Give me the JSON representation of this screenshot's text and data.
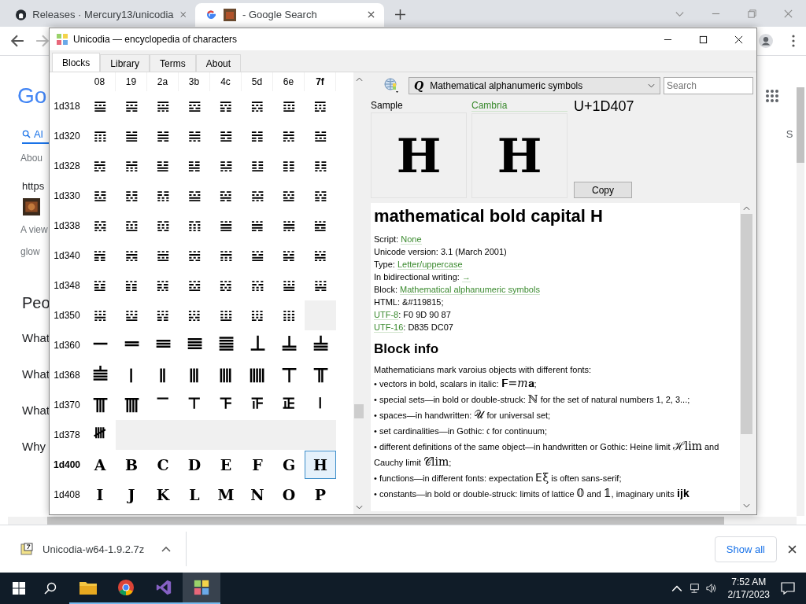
{
  "browser": {
    "tabs": [
      {
        "title": "Releases · Mercury13/unicodia",
        "selected": false
      },
      {
        "title": "- Google Search",
        "selected": true
      }
    ],
    "page_left": [
      {
        "kind": "logo",
        "text": "Go"
      },
      {
        "kind": "tab",
        "text": "Al"
      },
      {
        "kind": "small",
        "text": "Abou"
      },
      {
        "kind": "url",
        "text": "https"
      },
      {
        "kind": "thumb"
      },
      {
        "kind": "small",
        "text": "A view"
      },
      {
        "kind": "small",
        "text": "glow"
      },
      {
        "kind": "heading",
        "text": "Peo"
      },
      {
        "kind": "question",
        "text": "What"
      },
      {
        "kind": "question",
        "text": "What"
      },
      {
        "kind": "question",
        "text": "What"
      },
      {
        "kind": "question",
        "text": "Why"
      }
    ],
    "page_right": {
      "tab": "S"
    }
  },
  "window": {
    "title": "Unicodia — encyclopedia of characters",
    "tabs": [
      {
        "label": "Blocks",
        "selected": true
      },
      {
        "label": "Library",
        "selected": false
      },
      {
        "label": "Terms",
        "selected": false
      },
      {
        "label": "About",
        "selected": false
      }
    ]
  },
  "grid": {
    "columns": [
      {
        "label": "08",
        "current": false
      },
      {
        "label": "19",
        "current": false
      },
      {
        "label": "2a",
        "current": false
      },
      {
        "label": "3b",
        "current": false
      },
      {
        "label": "4c",
        "current": false
      },
      {
        "label": "5d",
        "current": false
      },
      {
        "label": "6e",
        "current": false
      },
      {
        "label": "7f",
        "current": true
      }
    ],
    "rows": [
      {
        "label": "1d318",
        "current": false,
        "cells": [
          {
            "char": "𝌘",
            "selected": false
          },
          {
            "char": "𝌙",
            "selected": false
          },
          {
            "char": "𝌚",
            "selected": false
          },
          {
            "char": "𝌛",
            "selected": false
          },
          {
            "char": "𝌜",
            "selected": false
          },
          {
            "char": "𝌝",
            "selected": false
          },
          {
            "char": "𝌞",
            "selected": false
          },
          {
            "char": "𝌟",
            "selected": false
          }
        ]
      },
      {
        "label": "1d320",
        "current": false,
        "cells": [
          {
            "char": "𝌠",
            "selected": false
          },
          {
            "char": "𝌡",
            "selected": false
          },
          {
            "char": "𝌢",
            "selected": false
          },
          {
            "char": "𝌣",
            "selected": false
          },
          {
            "char": "𝌤",
            "selected": false
          },
          {
            "char": "𝌥",
            "selected": false
          },
          {
            "char": "𝌦",
            "selected": false
          },
          {
            "char": "𝌧",
            "selected": false
          }
        ]
      },
      {
        "label": "1d328",
        "current": false,
        "cells": [
          {
            "char": "𝌨",
            "selected": false
          },
          {
            "char": "𝌩",
            "selected": false
          },
          {
            "char": "𝌪",
            "selected": false
          },
          {
            "char": "𝌫",
            "selected": false
          },
          {
            "char": "𝌬",
            "selected": false
          },
          {
            "char": "𝌭",
            "selected": false
          },
          {
            "char": "𝌮",
            "selected": false
          },
          {
            "char": "𝌯",
            "selected": false
          }
        ]
      },
      {
        "label": "1d330",
        "current": false,
        "cells": [
          {
            "char": "𝌰",
            "selected": false
          },
          {
            "char": "𝌱",
            "selected": false
          },
          {
            "char": "𝌲",
            "selected": false
          },
          {
            "char": "𝌳",
            "selected": false
          },
          {
            "char": "𝌴",
            "selected": false
          },
          {
            "char": "𝌵",
            "selected": false
          },
          {
            "char": "𝌶",
            "selected": false
          },
          {
            "char": "𝌷",
            "selected": false
          }
        ]
      },
      {
        "label": "1d338",
        "current": false,
        "cells": [
          {
            "char": "𝌸",
            "selected": false
          },
          {
            "char": "𝌹",
            "selected": false
          },
          {
            "char": "𝌺",
            "selected": false
          },
          {
            "char": "𝌻",
            "selected": false
          },
          {
            "char": "𝌼",
            "selected": false
          },
          {
            "char": "𝌽",
            "selected": false
          },
          {
            "char": "𝌾",
            "selected": false
          },
          {
            "char": "𝌿",
            "selected": false
          }
        ]
      },
      {
        "label": "1d340",
        "current": false,
        "cells": [
          {
            "char": "𝍀",
            "selected": false
          },
          {
            "char": "𝍁",
            "selected": false
          },
          {
            "char": "𝍂",
            "selected": false
          },
          {
            "char": "𝍃",
            "selected": false
          },
          {
            "char": "𝍄",
            "selected": false
          },
          {
            "char": "𝍅",
            "selected": false
          },
          {
            "char": "𝍆",
            "selected": false
          },
          {
            "char": "𝍇",
            "selected": false
          }
        ]
      },
      {
        "label": "1d348",
        "current": false,
        "cells": [
          {
            "char": "𝍈",
            "selected": false
          },
          {
            "char": "𝍉",
            "selected": false
          },
          {
            "char": "𝍊",
            "selected": false
          },
          {
            "char": "𝍋",
            "selected": false
          },
          {
            "char": "𝍌",
            "selected": false
          },
          {
            "char": "𝍍",
            "selected": false
          },
          {
            "char": "𝍎",
            "selected": false
          },
          {
            "char": "𝍏",
            "selected": false
          }
        ]
      },
      {
        "label": "1d350",
        "current": false,
        "cells": [
          {
            "char": "𝍐",
            "selected": false
          },
          {
            "char": "𝍑",
            "selected": false
          },
          {
            "char": "𝍒",
            "selected": false
          },
          {
            "char": "𝍓",
            "selected": false
          },
          {
            "char": "𝍔",
            "selected": false
          },
          {
            "char": "𝍕",
            "selected": false
          },
          {
            "char": "𝍖",
            "selected": false
          }
        ]
      },
      {
        "label": "1d360",
        "current": false,
        "cells": [
          {
            "char": "𝍠",
            "selected": false
          },
          {
            "char": "𝍡",
            "selected": false
          },
          {
            "char": "𝍢",
            "selected": false
          },
          {
            "char": "𝍣",
            "selected": false
          },
          {
            "char": "𝍤",
            "selected": false
          },
          {
            "char": "𝍥",
            "selected": false
          },
          {
            "char": "𝍦",
            "selected": false
          },
          {
            "char": "𝍧",
            "selected": false
          }
        ]
      },
      {
        "label": "1d368",
        "current": false,
        "cells": [
          {
            "char": "𝍨",
            "selected": false
          },
          {
            "char": "𝍩",
            "selected": false
          },
          {
            "char": "𝍪",
            "selected": false
          },
          {
            "char": "𝍫",
            "selected": false
          },
          {
            "char": "𝍬",
            "selected": false
          },
          {
            "char": "𝍭",
            "selected": false
          },
          {
            "char": "𝍮",
            "selected": false
          },
          {
            "char": "𝍯",
            "selected": false
          }
        ]
      },
      {
        "label": "1d370",
        "current": false,
        "cells": [
          {
            "char": "𝍰",
            "selected": false
          },
          {
            "char": "𝍱",
            "selected": false
          },
          {
            "char": "𝍲",
            "selected": false
          },
          {
            "char": "𝍳",
            "selected": false
          },
          {
            "char": "𝍴",
            "selected": false
          },
          {
            "char": "𝍵",
            "selected": false
          },
          {
            "char": "𝍶",
            "selected": false
          },
          {
            "char": "𝍷",
            "selected": false
          }
        ]
      },
      {
        "label": "1d378",
        "current": false,
        "cells": [
          {
            "char": "𝍸",
            "selected": false
          }
        ]
      },
      {
        "label": "1d400",
        "current": true,
        "cells": [
          {
            "char": "𝐀",
            "selected": false
          },
          {
            "char": "𝐁",
            "selected": false
          },
          {
            "char": "𝐂",
            "selected": false
          },
          {
            "char": "𝐃",
            "selected": false
          },
          {
            "char": "𝐄",
            "selected": false
          },
          {
            "char": "𝐅",
            "selected": false
          },
          {
            "char": "𝐆",
            "selected": false
          },
          {
            "char": "𝐇",
            "selected": true
          }
        ]
      },
      {
        "label": "1d408",
        "current": false,
        "cells": [
          {
            "char": "𝐈",
            "selected": false
          },
          {
            "char": "𝐉",
            "selected": false
          },
          {
            "char": "𝐊",
            "selected": false
          },
          {
            "char": "𝐋",
            "selected": false
          },
          {
            "char": "𝐌",
            "selected": false
          },
          {
            "char": "𝐍",
            "selected": false
          },
          {
            "char": "𝐎",
            "selected": false
          },
          {
            "char": "𝐏",
            "selected": false
          }
        ]
      }
    ]
  },
  "toolbar": {
    "block_icon": "𝑸",
    "block": "Mathematical alphanumeric symbols",
    "search": {
      "placeholder": "Search"
    }
  },
  "samples": [
    {
      "label": "Sample",
      "link": false,
      "char": "𝐇"
    },
    {
      "label": "Cambria",
      "link": true,
      "char": "𝐇"
    }
  ],
  "code": "U+1D407",
  "copy": "Copy",
  "info": {
    "title": "mathematical bold capital H",
    "lines": [
      [
        {
          "text": "Script: ",
          "link": false
        },
        {
          "text": "None",
          "link": true
        }
      ],
      [
        {
          "text": "Unicode version: 3.1 (March 2001)",
          "link": false
        }
      ],
      [
        {
          "text": "Type: ",
          "link": false
        },
        {
          "text": "Letter/uppercase",
          "link": true
        }
      ],
      [
        {
          "text": "In bidirectional writing: ",
          "link": false
        },
        {
          "text": "→",
          "link": true
        }
      ],
      [
        {
          "text": "Block: ",
          "link": false
        },
        {
          "text": "Mathematical alphanumeric symbols",
          "link": true
        }
      ],
      [
        {
          "text": "HTML: &#119815;",
          "link": false
        }
      ],
      [
        {
          "text": "UTF-8",
          "link": true
        },
        {
          "text": ": F0 9D 90 87",
          "link": false
        }
      ],
      [
        {
          "text": "UTF-16",
          "link": true
        },
        {
          "text": ": D835 DC07",
          "link": false
        }
      ]
    ],
    "section": "Block info",
    "intro": "Mathematicians mark varoius objects with different fonts:",
    "bullets": [
      [
        {
          "text": "• vectors in bold, scalars in italic: ",
          "math": false
        },
        {
          "text": "𝐅=𝑚𝐚",
          "math": true
        },
        {
          "text": ";",
          "math": false
        }
      ],
      [
        {
          "text": "• special sets—in bold or double-struck: ",
          "math": false
        },
        {
          "text": "ℕ",
          "math": true
        },
        {
          "text": " for the set of natural numbers 1, 2, 3...;",
          "math": false
        }
      ],
      [
        {
          "text": "• spaces—in handwritten: ",
          "math": false
        },
        {
          "text": "𝒰",
          "math": true
        },
        {
          "text": " for universal set;",
          "math": false
        }
      ],
      [
        {
          "text": "• set cardinalities—in Gothic: ",
          "math": false
        },
        {
          "text": "𝔠",
          "math": true
        },
        {
          "text": " for continuum;",
          "math": false
        }
      ],
      [
        {
          "text": "• different definitions of the same object—in handwritten or Gothic: Heine limit ",
          "math": false
        },
        {
          "text": "ℋlim",
          "math": true
        },
        {
          "text": " and Cauchy limit ",
          "math": false
        },
        {
          "text": "𝒞lim",
          "math": true
        },
        {
          "text": ";",
          "math": false
        }
      ],
      [
        {
          "text": "• functions—in different fonts: expectation ",
          "math": false
        },
        {
          "text": "𝖤ξ",
          "math": true
        },
        {
          "text": " is often sans-serif;",
          "math": false
        }
      ],
      [
        {
          "text": "• constants—in bold or double-struck: limits of lattice ",
          "math": false
        },
        {
          "text": "𝟘",
          "math": true
        },
        {
          "text": " and ",
          "math": false
        },
        {
          "text": "𝟙",
          "math": true
        },
        {
          "text": ", imaginary units ",
          "math": false
        },
        {
          "text": "𝐢𝐣𝐤",
          "math": true
        }
      ]
    ]
  },
  "downloads": {
    "file": "Unicodia-w64-1.9.2.7z",
    "show_all": "Show all"
  },
  "taskbar": {
    "apps": [
      {
        "kind": "explorer",
        "active": false
      },
      {
        "kind": "chrome",
        "active": false
      },
      {
        "kind": "vs",
        "active": false
      },
      {
        "kind": "unicodia",
        "active": true
      }
    ],
    "time": "7:52 AM",
    "date": "2/17/2023"
  }
}
